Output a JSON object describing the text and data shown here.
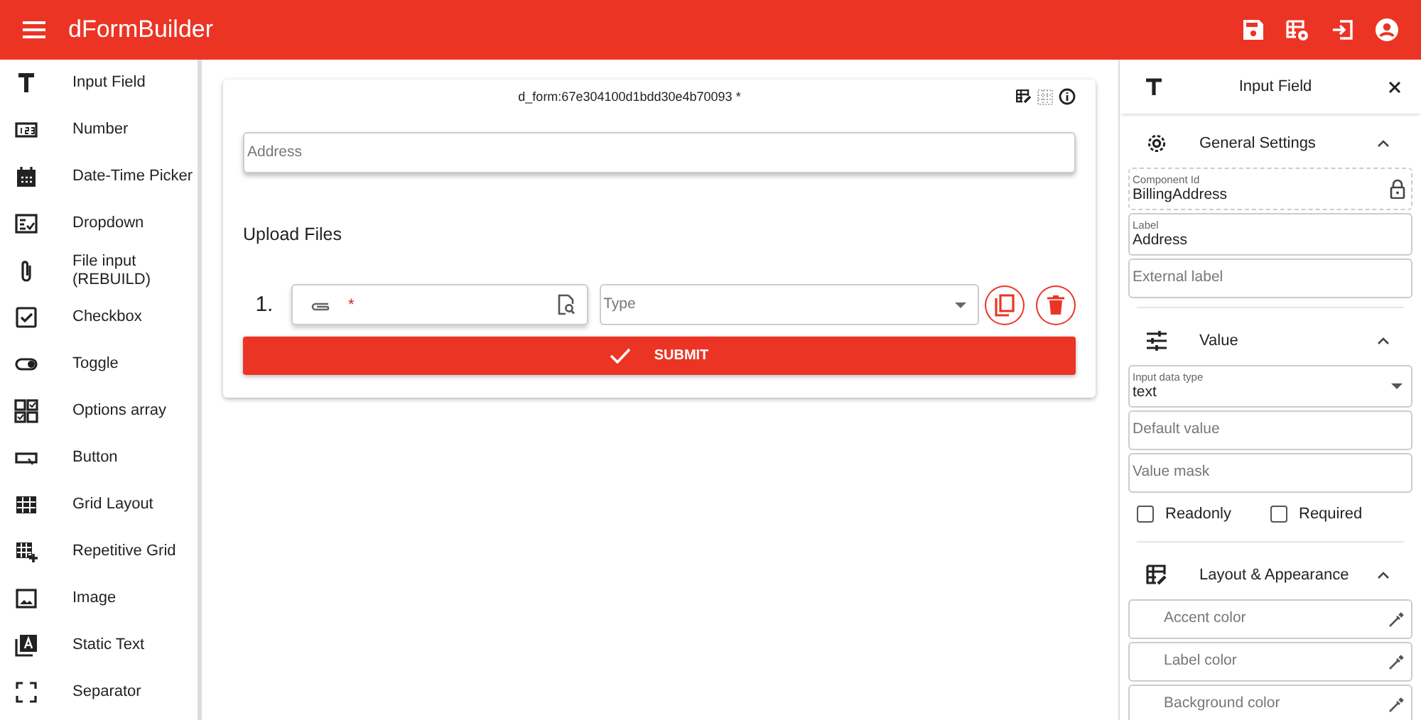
{
  "app_bar": {
    "title": "dFormBuilder"
  },
  "palette": [
    {
      "label": "Input Field",
      "kind": "text"
    },
    {
      "label": "Number",
      "kind": "number"
    },
    {
      "label": "Date-Time Picker",
      "kind": "calendar"
    },
    {
      "label": "Dropdown",
      "kind": "dropdown"
    },
    {
      "label": "File input (REBUILD)",
      "kind": "clip"
    },
    {
      "label": "Checkbox",
      "kind": "checkbox"
    },
    {
      "label": "Toggle",
      "kind": "toggle"
    },
    {
      "label": "Options array",
      "kind": "options"
    },
    {
      "label": "Button",
      "kind": "button"
    },
    {
      "label": "Grid Layout",
      "kind": "grid"
    },
    {
      "label": "Repetitive Grid",
      "kind": "gridplus"
    },
    {
      "label": "Image",
      "kind": "image"
    },
    {
      "label": "Static Text",
      "kind": "statictext"
    },
    {
      "label": "Separator",
      "kind": "separator"
    }
  ],
  "form": {
    "title": "d_form:67e304100d1bdd30e4b70093 *",
    "address": {
      "placeholder": "Address"
    },
    "upload": {
      "heading": "Upload Files",
      "rows": [
        {
          "number": "1.",
          "required_mark": "*",
          "type_placeholder": "Type"
        }
      ]
    },
    "submit": "SUBMIT"
  },
  "inspector": {
    "title": "Input Field",
    "sections": [
      {
        "title": "General Settings",
        "kind": "gear",
        "expanded": true,
        "fields": [
          {
            "kind": "locked",
            "label": "Component Id",
            "value": "BillingAddress"
          },
          {
            "kind": "text",
            "label": "Label",
            "value": "Address"
          },
          {
            "kind": "text",
            "placeholder": "External label"
          }
        ]
      },
      {
        "title": "Value",
        "kind": "tune",
        "expanded": true,
        "fields": [
          {
            "kind": "select",
            "label": "Input data type",
            "value": "text"
          },
          {
            "kind": "text",
            "placeholder": "Default value"
          },
          {
            "kind": "text",
            "placeholder": "Value mask"
          },
          {
            "kind": "checks",
            "items": [
              {
                "label": "Readonly",
                "checked": false
              },
              {
                "label": "Required",
                "checked": false
              }
            ]
          }
        ]
      },
      {
        "title": "Layout & Appearance",
        "kind": "layout",
        "expanded": true,
        "fields": [
          {
            "kind": "color",
            "placeholder": "Accent color"
          },
          {
            "kind": "color",
            "placeholder": "Label color"
          },
          {
            "kind": "color",
            "placeholder": "Background color"
          }
        ]
      }
    ]
  }
}
